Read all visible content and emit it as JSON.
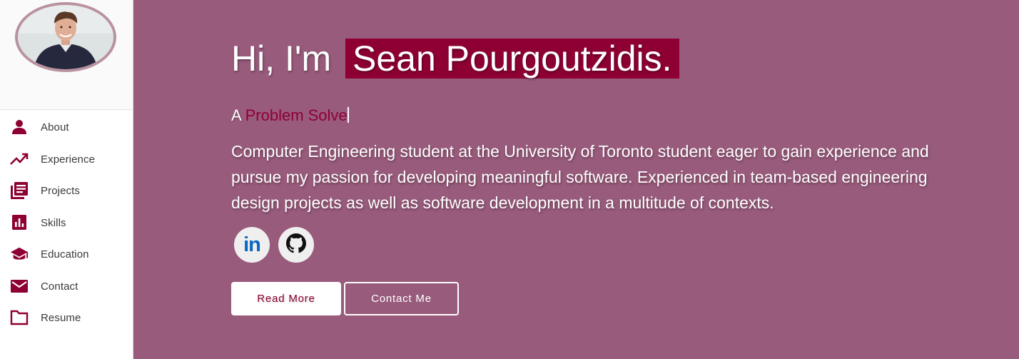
{
  "sidebar": {
    "items": [
      {
        "label": "About",
        "icon": "person-icon"
      },
      {
        "label": "Experience",
        "icon": "trending-up-icon"
      },
      {
        "label": "Projects",
        "icon": "library-books-icon"
      },
      {
        "label": "Skills",
        "icon": "bar-chart-icon"
      },
      {
        "label": "Education",
        "icon": "graduation-cap-icon"
      },
      {
        "label": "Contact",
        "icon": "mail-icon"
      },
      {
        "label": "Resume",
        "icon": "folder-icon"
      }
    ]
  },
  "hero": {
    "greeting": "Hi, I'm",
    "name": "Sean Pourgoutzidis.",
    "tagline_prefix": "A",
    "tagline_role": "Problem Solve",
    "bio": "Computer Engineering student at the University of Toronto student eager to gain experience and pursue my passion for developing meaningful software. Experienced in team-based engineering design projects as well as software development in a multitude of contexts.",
    "social": [
      {
        "icon": "linkedin-icon",
        "label": "in"
      },
      {
        "icon": "github-icon"
      }
    ],
    "buttons": {
      "read_more": "Read More",
      "contact_me": "Contact Me"
    }
  },
  "colors": {
    "accent": "#8e0033",
    "background": "#995b7c",
    "linkedin": "#0a66c2"
  }
}
